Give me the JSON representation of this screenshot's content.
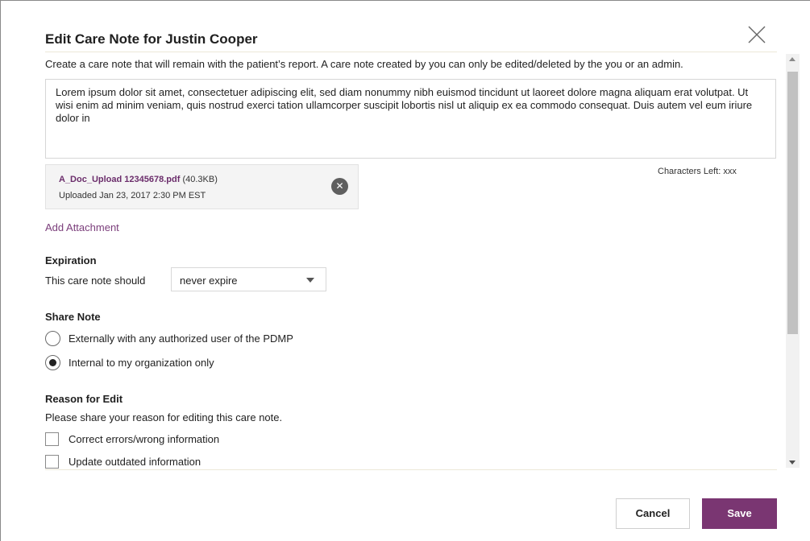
{
  "modal": {
    "title": "Edit Care Note for Justin Cooper",
    "close_icon": "close-icon",
    "intro": "Create a care note that will remain with the patient’s report. A care note created by you can only be edited/deleted by the you or an admin."
  },
  "note": {
    "text": "Lorem ipsum dolor sit amet, consectetuer adipiscing elit, sed diam nonummy nibh euismod tincidunt ut laoreet dolore magna aliquam erat volutpat. Ut wisi enim ad minim veniam, quis nostrud exerci tation ullamcorper suscipit lobortis nisl ut aliquip ex ea commodo consequat. Duis autem vel eum iriure dolor in",
    "characters_left": "Characters Left: xxx"
  },
  "attachment": {
    "filename": "A_Doc_Upload 12345678.pdf",
    "size": " (40.3KB)",
    "uploaded": "Uploaded Jan 23, 2017 2:30 PM EST",
    "remove_icon": "close-circle-icon",
    "add_label": "Add Attachment"
  },
  "expiration": {
    "heading": "Expiration",
    "prompt": "This care note should",
    "selected": "never expire"
  },
  "share": {
    "heading": "Share Note",
    "options": [
      {
        "label": "Externally with any authorized user of the PDMP",
        "checked": false
      },
      {
        "label": "Internal to my organization only",
        "checked": true
      }
    ]
  },
  "reason": {
    "heading": "Reason for Edit",
    "prompt": "Please share your reason for editing this care note.",
    "options": [
      {
        "label": "Correct errors/wrong information",
        "checked": false
      },
      {
        "label": "Update outdated information",
        "checked": false
      }
    ]
  },
  "footer": {
    "cancel_label": "Cancel",
    "save_label": "Save"
  },
  "colors": {
    "accent": "#7a3672",
    "link": "#7b3e7b"
  }
}
